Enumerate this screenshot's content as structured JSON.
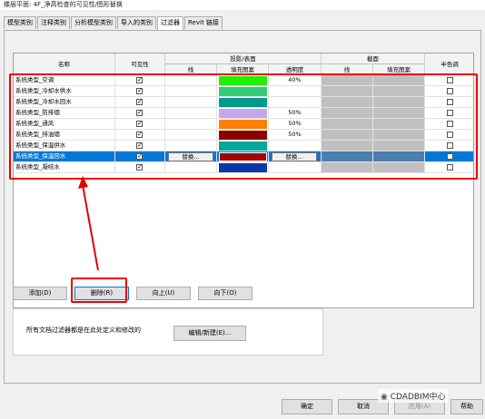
{
  "window": {
    "title": "楼层平面: 4F_净高检查的可见性/图形替换"
  },
  "tabs": [
    "模型类别",
    "注释类别",
    "分析模型类别",
    "导入的类别",
    "过滤器",
    "Revit 链接"
  ],
  "active_tab": 4,
  "table": {
    "headers": {
      "name": "名称",
      "visibility": "可见性",
      "projection": "投影/表面",
      "proj_line": "线",
      "proj_fill": "填充图案",
      "proj_transparency": "透明度",
      "cut": "截面",
      "cut_line": "线",
      "cut_fill": "填充图案",
      "halftone": "半色调"
    },
    "rows": [
      {
        "name": "系统类型_空调",
        "visible": true,
        "proj_line": "",
        "fill_color": "#22ee00",
        "transparency": "40%",
        "halftone": false,
        "selected": false
      },
      {
        "name": "系统类型_冷却水供水",
        "visible": true,
        "proj_line": "",
        "fill_color": "#33cc77",
        "transparency": "",
        "halftone": false,
        "selected": false
      },
      {
        "name": "系统类型_冷却水回水",
        "visible": true,
        "proj_line": "",
        "fill_color": "#009a8a",
        "transparency": "",
        "halftone": false,
        "selected": false
      },
      {
        "name": "系统类型_防排烟",
        "visible": true,
        "proj_line": "",
        "fill_color": "#c9a6ec",
        "transparency": "50%",
        "halftone": false,
        "selected": false
      },
      {
        "name": "系统类型_通风",
        "visible": true,
        "proj_line": "",
        "fill_color": "#ff7f00",
        "transparency": "50%",
        "halftone": false,
        "selected": false
      },
      {
        "name": "系统类型_排油烟",
        "visible": true,
        "proj_line": "",
        "fill_color": "#8a0000",
        "transparency": "50%",
        "halftone": false,
        "selected": false
      },
      {
        "name": "系统类型_保温供水",
        "visible": true,
        "proj_line": "",
        "fill_color": "#00a89a",
        "transparency": "",
        "halftone": false,
        "selected": false
      },
      {
        "name": "系统类型_保温回水",
        "visible": true,
        "proj_line": "替换...",
        "fill_color": "#a60000",
        "transparency": "替换...",
        "halftone": false,
        "selected": true
      },
      {
        "name": "系统类型_凝结水",
        "visible": true,
        "proj_line": "",
        "fill_color": "#0b3aa8",
        "transparency": "",
        "halftone": false,
        "selected": false
      }
    ]
  },
  "buttons": {
    "add": "添加(D)",
    "delete": "删除(R)",
    "up": "向上(U)",
    "down": "向下(O)",
    "edit_new": "编辑/新建(E)...",
    "ok": "确定",
    "cancel": "取消",
    "apply": "应用(A)",
    "help": "帮助"
  },
  "info_text": "所有文档过滤器都是在此处定义和修改的",
  "watermark": "CDADBIM中心",
  "colors": {
    "selection": "#0078d7",
    "annotation": "#e00000",
    "cut_gray": "#c0c0c0"
  }
}
